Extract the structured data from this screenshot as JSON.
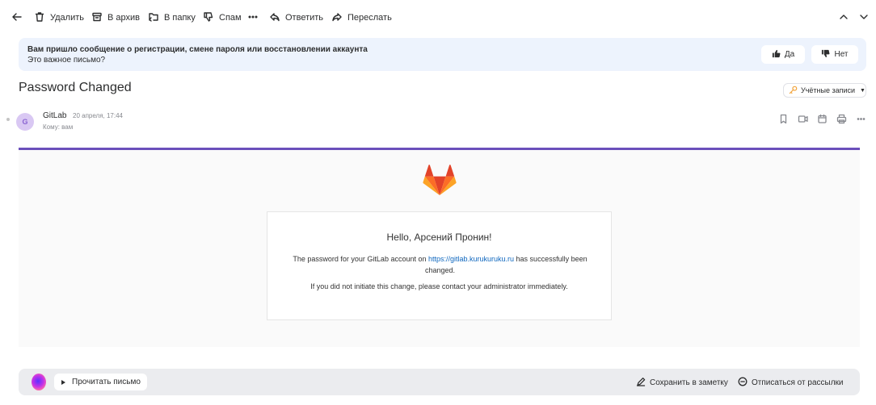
{
  "toolbar": {
    "delete_label": "Удалить",
    "archive_label": "В архив",
    "folder_label": "В папку",
    "spam_label": "Спам",
    "reply_label": "Ответить",
    "forward_label": "Переслать"
  },
  "banner": {
    "title": "Вам пришло сообщение о регистрации, смене пароля или восстановлении аккаунта",
    "question": "Это важное письмо?",
    "yes_label": "Да",
    "no_label": "Нет"
  },
  "message": {
    "subject": "Password Changed",
    "label_button": "Учётные записи",
    "sender_initial": "G",
    "sender_name": "GitLab",
    "date": "20 апреля, 17:44",
    "to": "Кому: вам"
  },
  "email_body": {
    "greeting": "Hello, Арсений Пронин!",
    "p1_before": "The password for your GitLab account on ",
    "p1_link": "https://gitlab.kurukuruku.ru",
    "p1_after": " has successfully been changed.",
    "p2": "If you did not initiate this change, please contact your administrator immediately."
  },
  "bottom_bar": {
    "read_label": "Прочитать письмо",
    "save_note_label": "Сохранить в заметку",
    "unsubscribe_label": "Отписаться от рассылки"
  },
  "colors": {
    "accent_bar": "#6b4fbb",
    "banner_bg": "#edf3fd",
    "link": "#1068bf",
    "avatar_bg": "#d9c8f3",
    "gitlab_orange": "#e24329"
  },
  "icons": [
    "back-arrow-icon",
    "trash-icon",
    "archive-icon",
    "folder-move-icon",
    "thumb-down-icon",
    "more-icon",
    "reply-icon",
    "forward-icon",
    "chevron-up-icon",
    "chevron-down-icon",
    "thumb-up-icon",
    "key-icon",
    "bookmark-icon",
    "video-icon",
    "calendar-icon",
    "print-icon",
    "gitlab-logo-icon",
    "note-icon",
    "unsubscribe-icon"
  ]
}
